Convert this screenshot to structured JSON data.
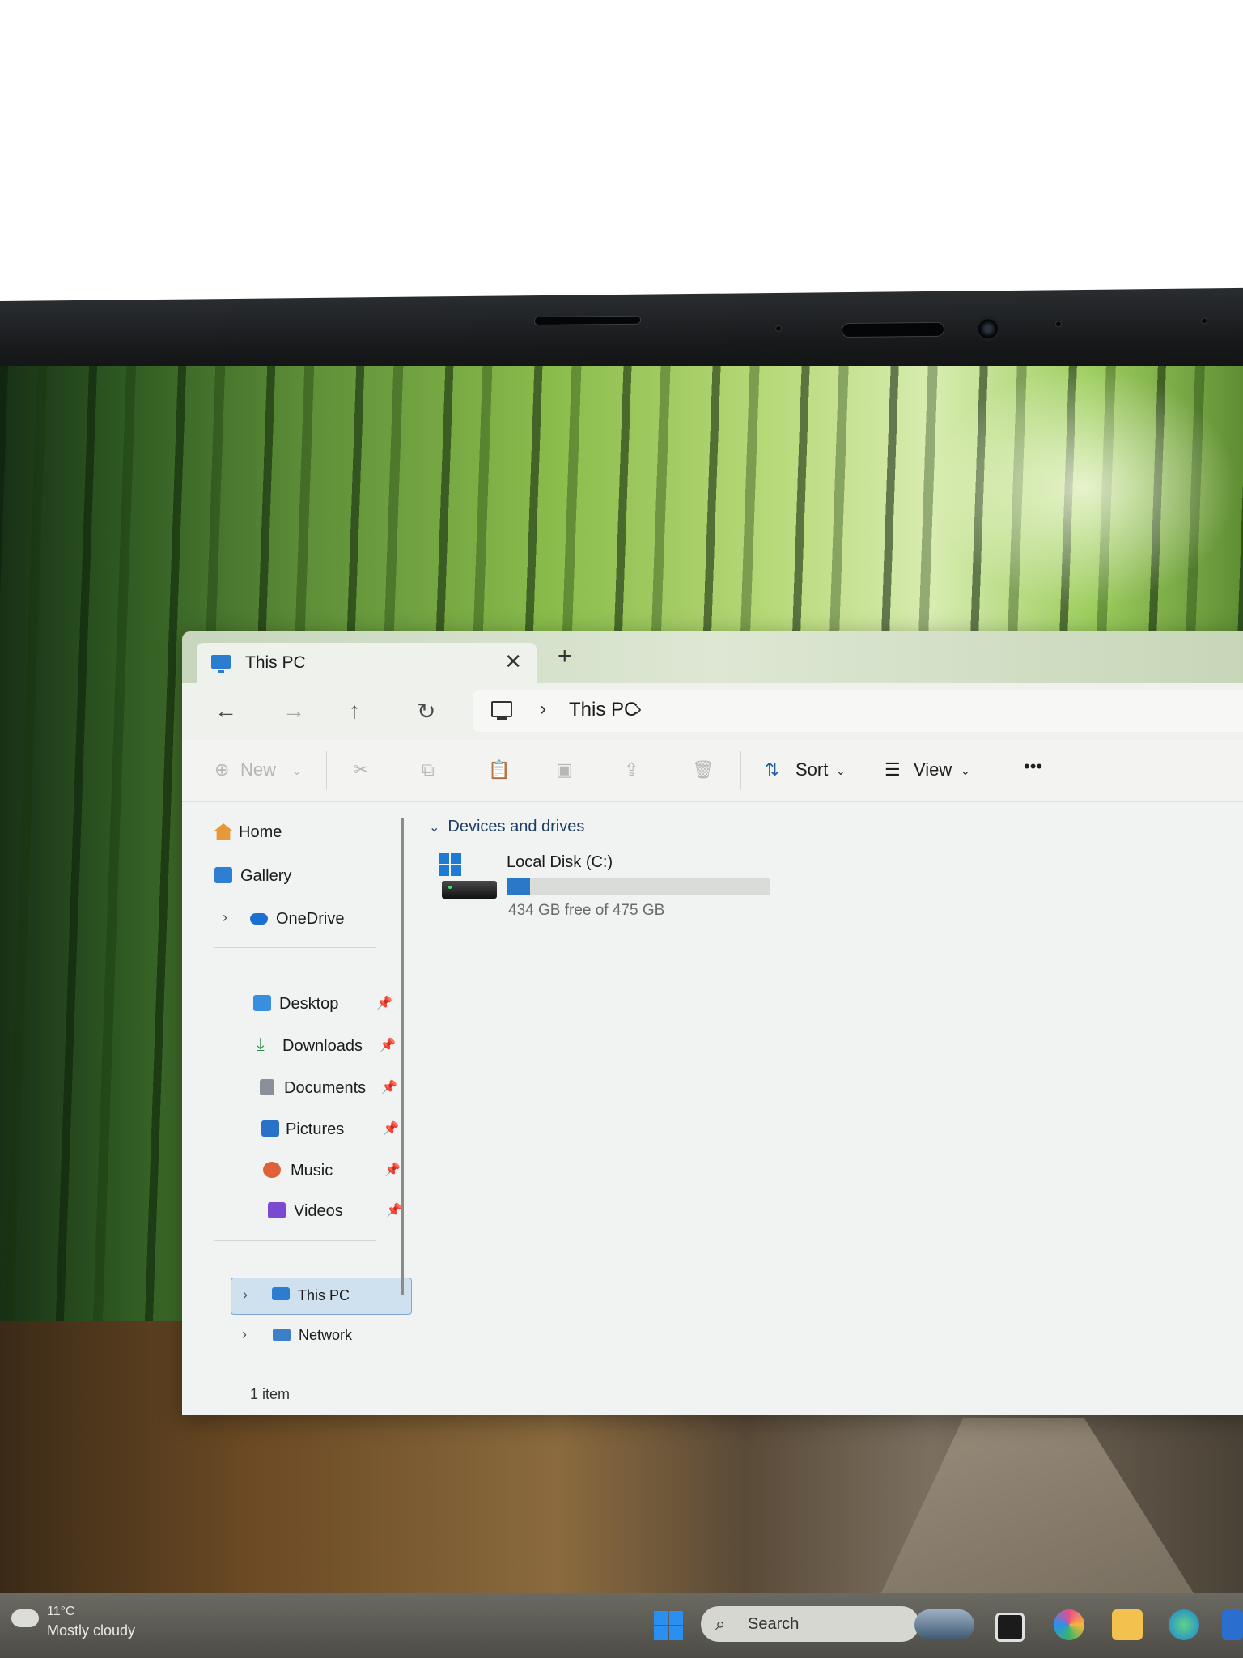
{
  "explorer": {
    "tab_title": "This PC",
    "new_tab": "+",
    "breadcrumb": [
      "This PC"
    ],
    "toolbar": {
      "new_label": "New",
      "sort_label": "Sort",
      "view_label": "View",
      "more_label": "•••"
    },
    "sidebar": {
      "items": [
        {
          "label": "Home",
          "icon": "home-icon"
        },
        {
          "label": "Gallery",
          "icon": "gallery-icon"
        },
        {
          "label": "OneDrive",
          "icon": "onedrive-icon"
        },
        {
          "label": "Desktop",
          "icon": "desktop-icon",
          "pinned": true
        },
        {
          "label": "Downloads",
          "icon": "downloads-icon",
          "pinned": true
        },
        {
          "label": "Documents",
          "icon": "documents-icon",
          "pinned": true
        },
        {
          "label": "Pictures",
          "icon": "pictures-icon",
          "pinned": true
        },
        {
          "label": "Music",
          "icon": "music-icon",
          "pinned": true
        },
        {
          "label": "Videos",
          "icon": "videos-icon",
          "pinned": true
        },
        {
          "label": "This PC",
          "icon": "this-pc-icon",
          "selected": true
        },
        {
          "label": "Network",
          "icon": "network-icon"
        }
      ]
    },
    "content": {
      "group_title": "Devices and drives",
      "drives": [
        {
          "name": "Local Disk (C:)",
          "free_text": "434 GB free of 475 GB",
          "used_fraction": 0.086
        }
      ]
    },
    "status": "1 item"
  },
  "taskbar": {
    "weather_temp": "11°C",
    "weather_desc": "Mostly cloudy",
    "search_label": "Search"
  },
  "colors": {
    "accent": "#2b78c6",
    "selection": "#cfe0ee"
  }
}
